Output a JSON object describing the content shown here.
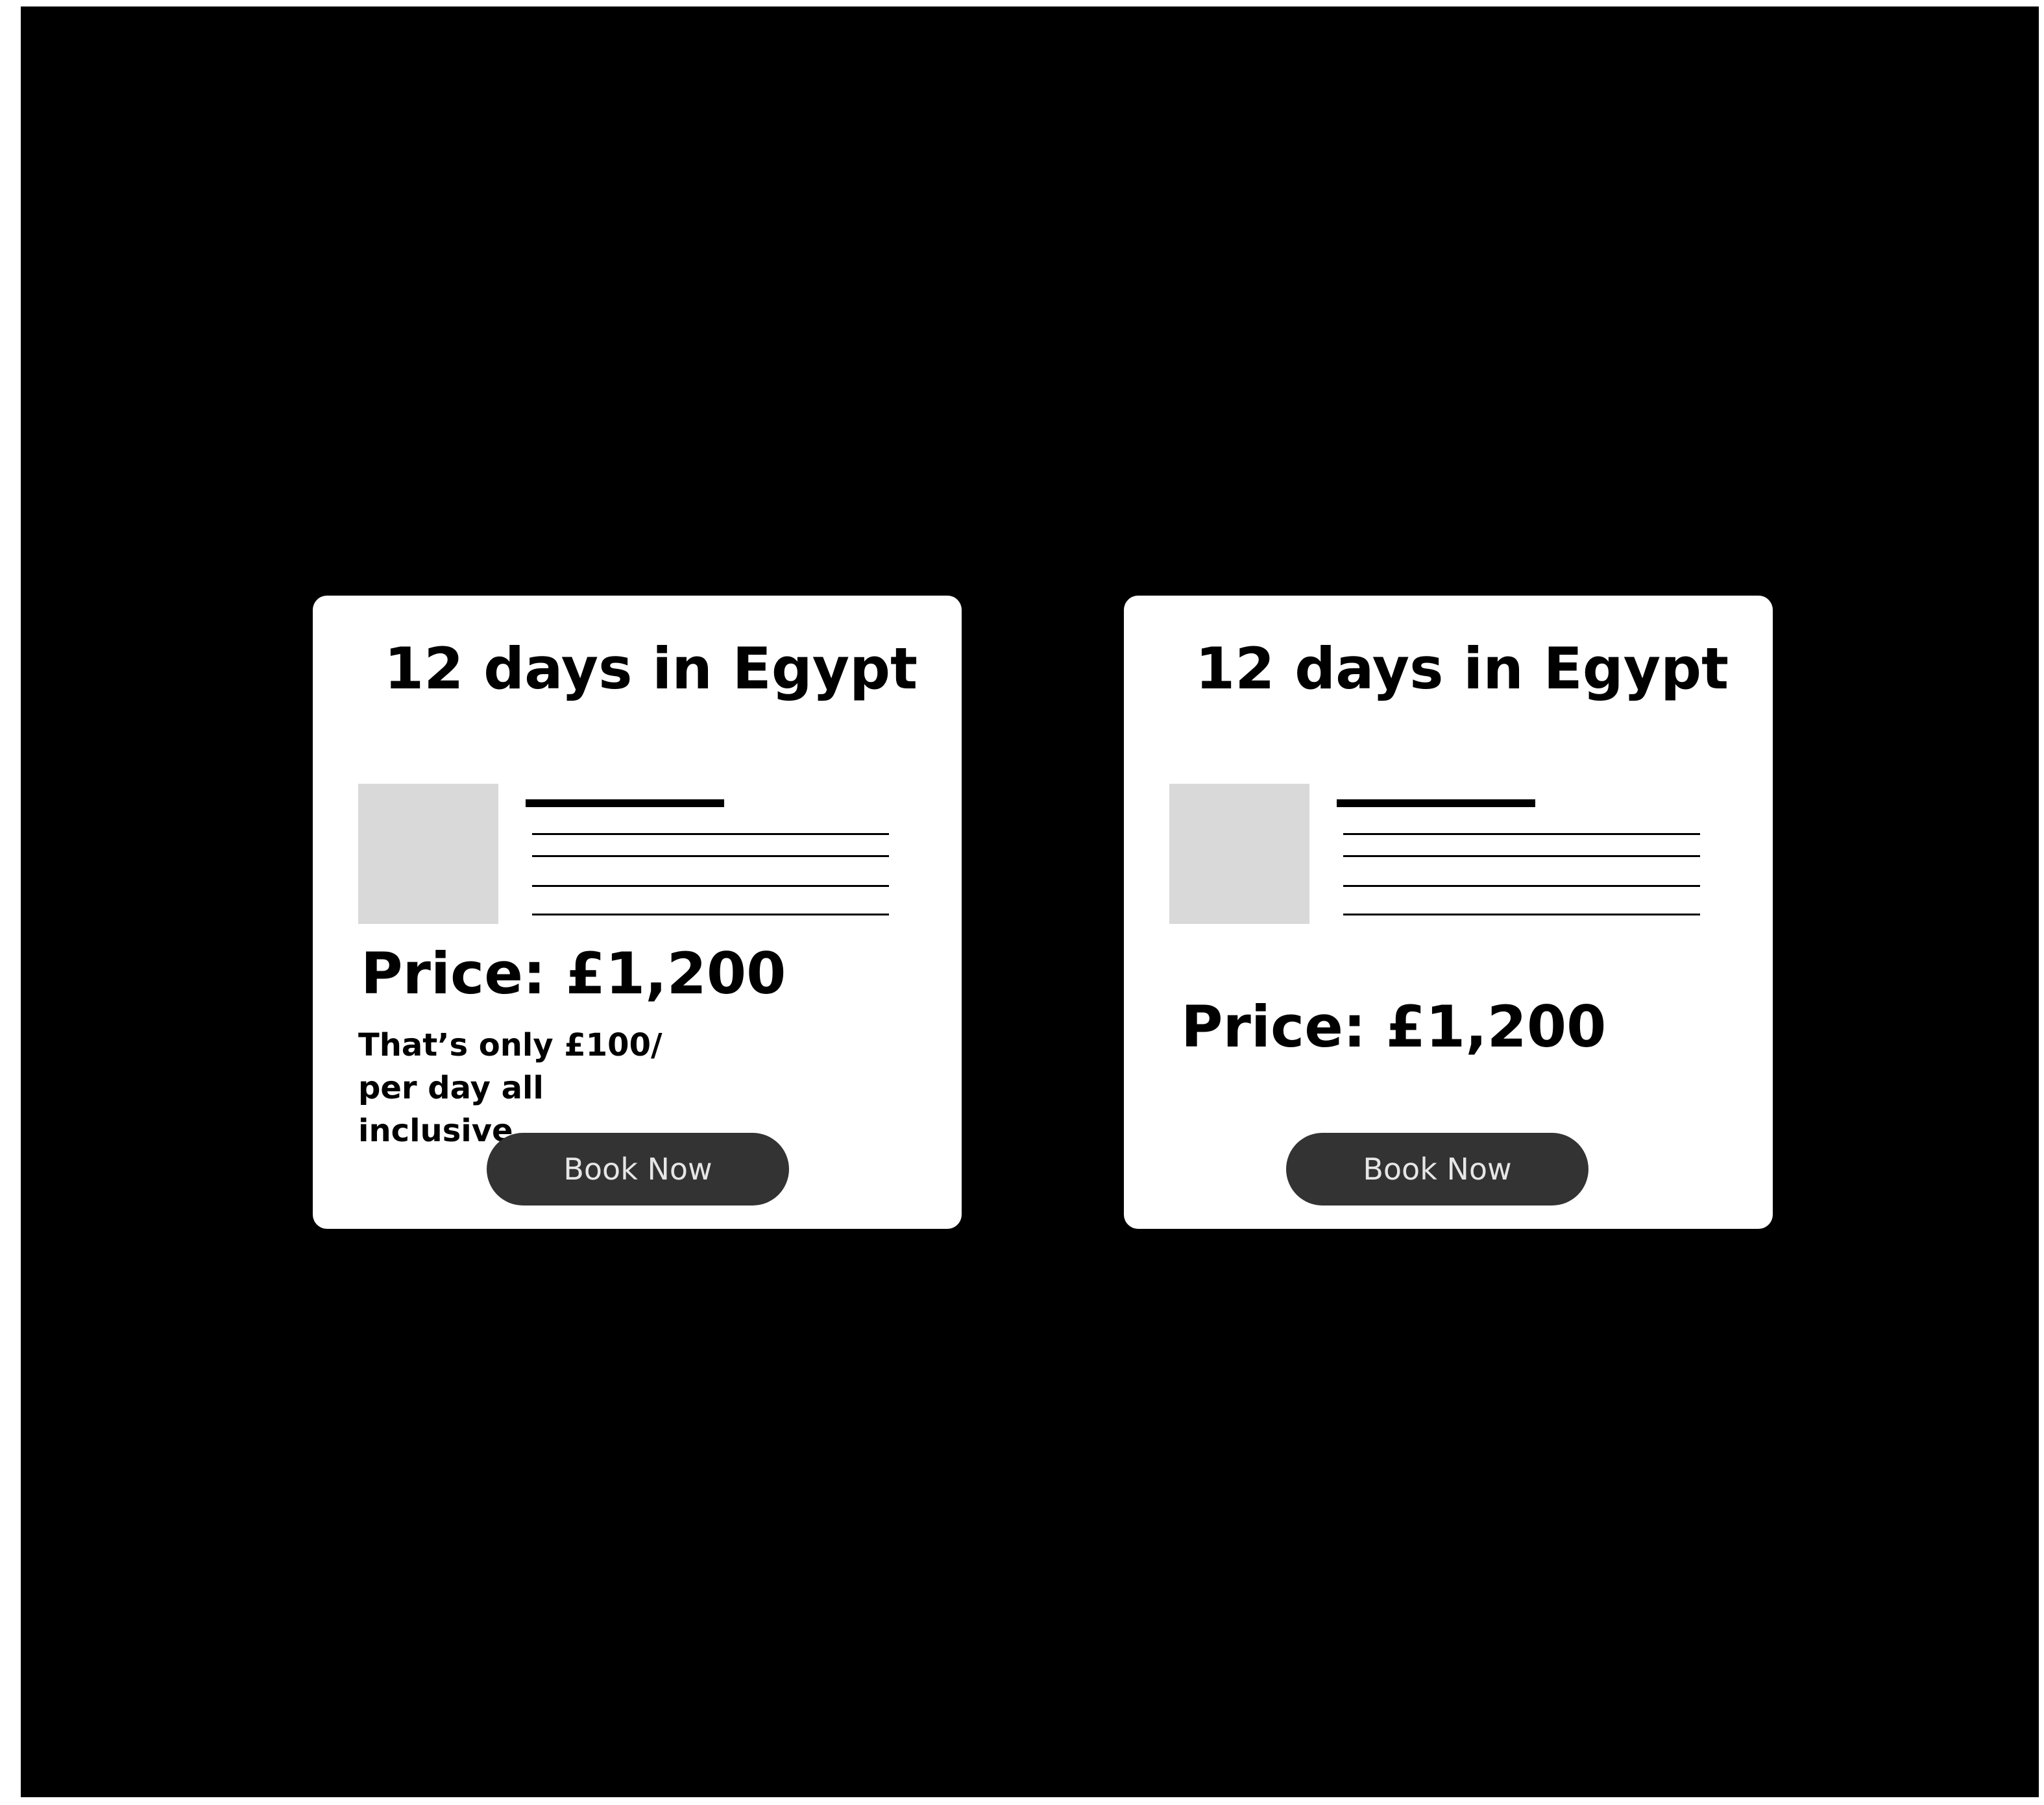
{
  "cards": [
    {
      "title": "12 days in Egypt",
      "price": "Price: £1,200",
      "note": "That’s only £100/ per day all  inclusive",
      "button_label": "Book Now"
    },
    {
      "title": "12 days in Egypt",
      "price": "Price: £1,200",
      "button_label": "Book Now"
    }
  ],
  "colors": {
    "canvas": "#000000",
    "card": "#ffffff",
    "placeholder": "#d9d9d9",
    "button": "#333333",
    "button_text": "#e6e6e6"
  }
}
